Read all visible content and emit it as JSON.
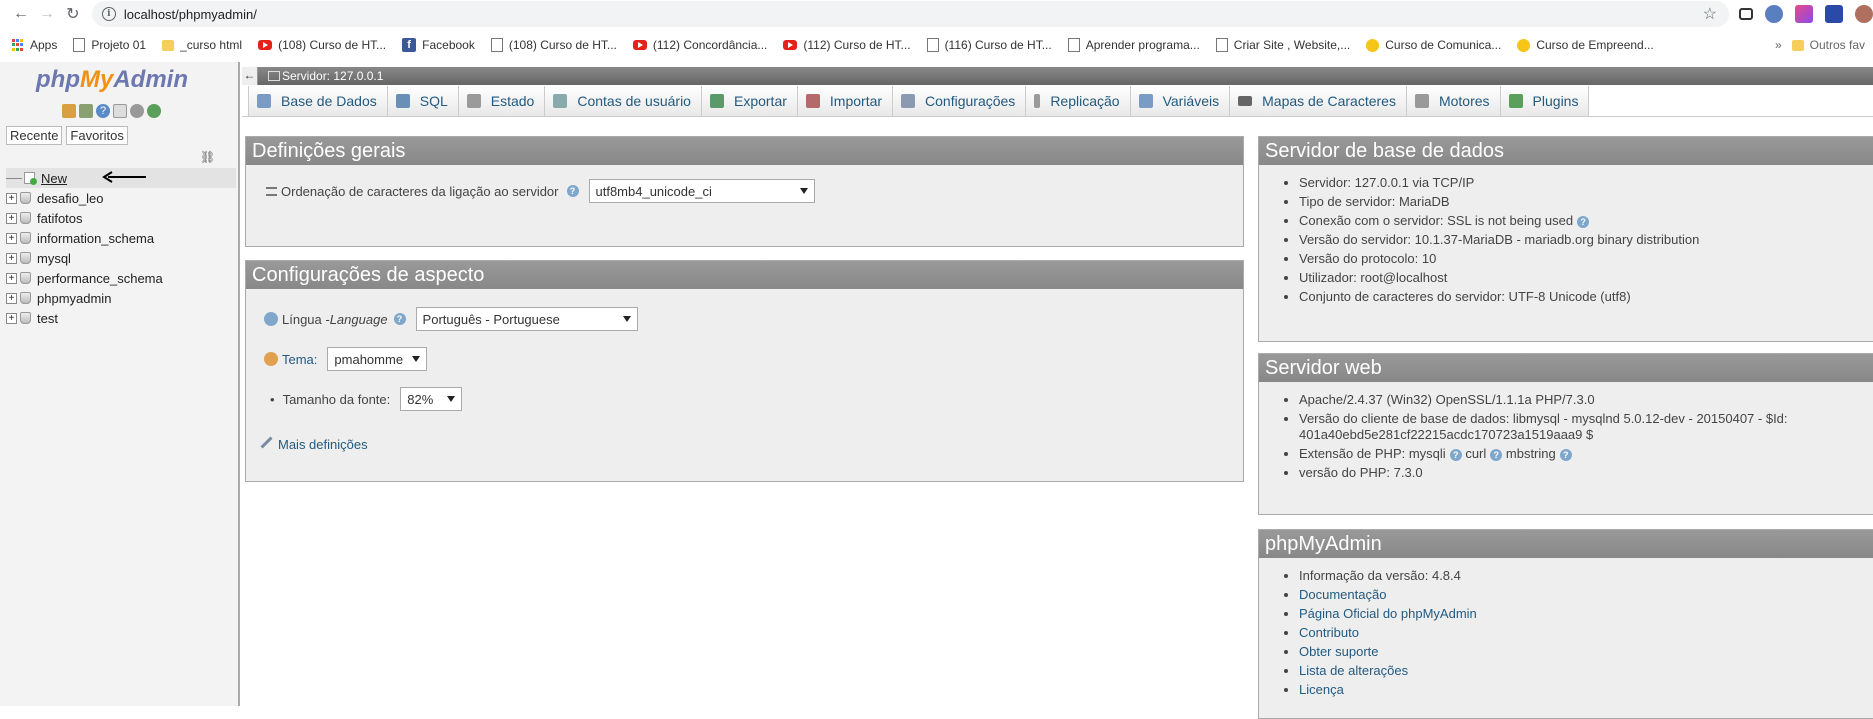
{
  "browser": {
    "url": "localhost/phpmyadmin/",
    "bookmarks": [
      {
        "label": "Apps",
        "icon": "apps-icon"
      },
      {
        "label": "Projeto 01",
        "icon": "page-icon"
      },
      {
        "label": "_curso html",
        "icon": "folder-icon"
      },
      {
        "label": "(108) Curso de HT...",
        "icon": "youtube-icon"
      },
      {
        "label": "Facebook",
        "icon": "facebook-icon"
      },
      {
        "label": "(108) Curso de HT...",
        "icon": "page-icon"
      },
      {
        "label": "(112) Concordância...",
        "icon": "youtube-icon"
      },
      {
        "label": "(112) Curso de HT...",
        "icon": "youtube-icon"
      },
      {
        "label": "(116) Curso de HT...",
        "icon": "page-icon"
      },
      {
        "label": "Aprender programa...",
        "icon": "page-icon"
      },
      {
        "label": "Criar Site , Website,...",
        "icon": "page-icon"
      },
      {
        "label": "Curso de Comunica...",
        "icon": "coin-icon"
      },
      {
        "label": "Curso de Empreend...",
        "icon": "coin-icon"
      }
    ],
    "more_label": "»",
    "other_bookmarks": "Outros fav"
  },
  "sidebar": {
    "logo": {
      "php": "php",
      "my": "My",
      "admin": "Admin"
    },
    "recent_label": "Recente",
    "favorites_label": "Favoritos",
    "new_label": "New",
    "databases": [
      "desafio_leo",
      "fatifotos",
      "information_schema",
      "mysql",
      "performance_schema",
      "phpmyadmin",
      "test"
    ]
  },
  "header": {
    "server_label": "Servidor: 127.0.0.1",
    "tabs": [
      {
        "label": "Base de Dados",
        "color": "#7a9cc4"
      },
      {
        "label": "SQL",
        "color": "#6a8fb6"
      },
      {
        "label": "Estado",
        "color": "#9a9a9a"
      },
      {
        "label": "Contas de usuário",
        "color": "#8aa"
      },
      {
        "label": "Exportar",
        "color": "#5a9a6a"
      },
      {
        "label": "Importar",
        "color": "#b46a6a"
      },
      {
        "label": "Configurações",
        "color": "#8a9ab0"
      },
      {
        "label": "Replicação",
        "color": "#9a9a9a"
      },
      {
        "label": "Variáveis",
        "color": "#7a9cc4"
      },
      {
        "label": "Mapas de Caracteres",
        "color": "#666"
      },
      {
        "label": "Motores",
        "color": "#999"
      },
      {
        "label": "Plugins",
        "color": "#5aa05a"
      }
    ]
  },
  "general": {
    "title": "Definições gerais",
    "collation_label": "Ordenação de caracteres da ligação ao servidor",
    "collation_value": "utf8mb4_unicode_ci"
  },
  "appearance": {
    "title": "Configurações de aspecto",
    "language_label": "Língua - ",
    "language_italic": "Language",
    "language_value": "Português - Portuguese",
    "theme_label": "Tema:",
    "theme_value": "pmahomme",
    "font_size_label": "Tamanho da fonte:",
    "font_size_value": "82%",
    "more_settings": "Mais definições"
  },
  "db_server": {
    "title": "Servidor de base de dados",
    "items": [
      "Servidor: 127.0.0.1 via TCP/IP",
      "Tipo de servidor: MariaDB",
      "Conexão com o servidor: SSL is not being used",
      "Versão do servidor: 10.1.37-MariaDB - mariadb.org binary distribution",
      "Versão do protocolo: 10",
      "Utilizador: root@localhost",
      "Conjunto de caracteres do servidor: UTF-8 Unicode (utf8)"
    ]
  },
  "web_server": {
    "title": "Servidor web",
    "items": [
      "Apache/2.4.37 (Win32) OpenSSL/1.1.1a PHP/7.3.0",
      "Versão do cliente de base de dados: libmysql - mysqlnd 5.0.12-dev - 20150407 - $Id:",
      "401a40ebd5e281cf22215acdc170723a1519aaa9 $",
      "Extensão de PHP: mysqli",
      "curl",
      "mbstring",
      "versão do PHP: 7.3.0"
    ]
  },
  "pma": {
    "title": "phpMyAdmin",
    "version": "Informação da versão: 4.8.4",
    "links": [
      "Documentação",
      "Página Oficial do phpMyAdmin",
      "Contributo",
      "Obter suporte",
      "Lista de alterações",
      "Licença"
    ]
  }
}
